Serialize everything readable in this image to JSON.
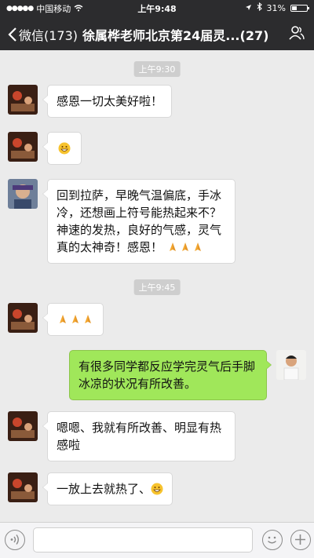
{
  "status_bar": {
    "carrier": "中国移动",
    "time": "上午9:48",
    "battery": "31%",
    "battery_level": 0.31
  },
  "nav": {
    "back_label": "微信(173)",
    "title": "徐属桦老师北京第24届灵...(27)"
  },
  "messages": [
    {
      "type": "time",
      "text": "上午9:30"
    },
    {
      "type": "left",
      "text": "感恩一切太美好啦！"
    },
    {
      "type": "left",
      "emoji": "grinning-face"
    },
    {
      "type": "left",
      "text": "回到拉萨，早晚气温偏底，手冰冷，还想画上符号能热起来不？神速的发热，良好的气感，灵气真的太神奇！感恩！",
      "trailing_emoji": "folded-hands-x3"
    },
    {
      "type": "time",
      "text": "上午9:45"
    },
    {
      "type": "left",
      "emoji": "folded-hands-x3"
    },
    {
      "type": "right",
      "text": "有很多同学都反应学完灵气后手脚冰凉的状况有所改善。"
    },
    {
      "type": "left",
      "text": "嗯嗯、我就有所改善、明显有热感啦"
    },
    {
      "type": "left",
      "text": "一放上去就热了、",
      "trailing_emoji": "grinning-face"
    }
  ],
  "colors": {
    "nav_bg": "#2c2c2e",
    "chat_bg": "#ebebeb",
    "bubble_green": "#a0e75a",
    "bubble_white": "#ffffff"
  }
}
